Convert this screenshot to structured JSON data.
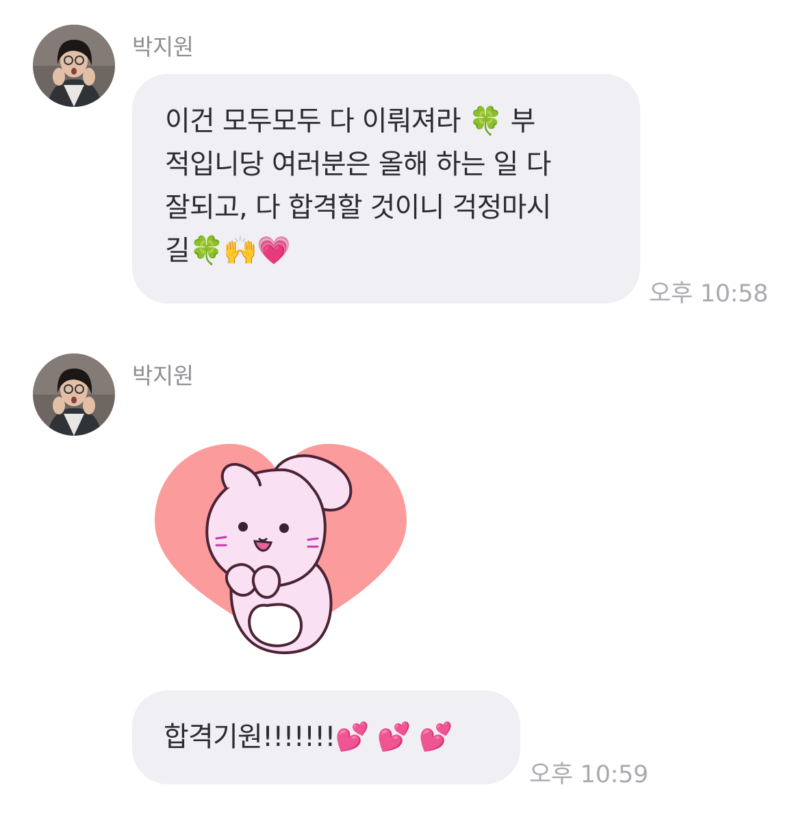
{
  "messages": [
    {
      "sender": "박지원",
      "text_lines": [
        "이건 모두모두 다 이뤄져라 🍀 부",
        "적입니당 여러분은 올해 하는 일 다",
        "잘되고, 다 합격할 것이니 걱정마시",
        "길🍀🙌💗"
      ],
      "time": "오후 10:58"
    },
    {
      "sender": "박지원",
      "sticker": "bunny-heart-sticker",
      "text": "합격기원!!!!!!!💕 💕 💕",
      "time": "오후 10:59"
    }
  ],
  "colors": {
    "bubble": "#efeff4",
    "name": "#8e8e93",
    "timestamp": "#a9a9b0",
    "sticker_heart": "#fb9b9b",
    "sticker_bunny": "#f9e0f3"
  }
}
